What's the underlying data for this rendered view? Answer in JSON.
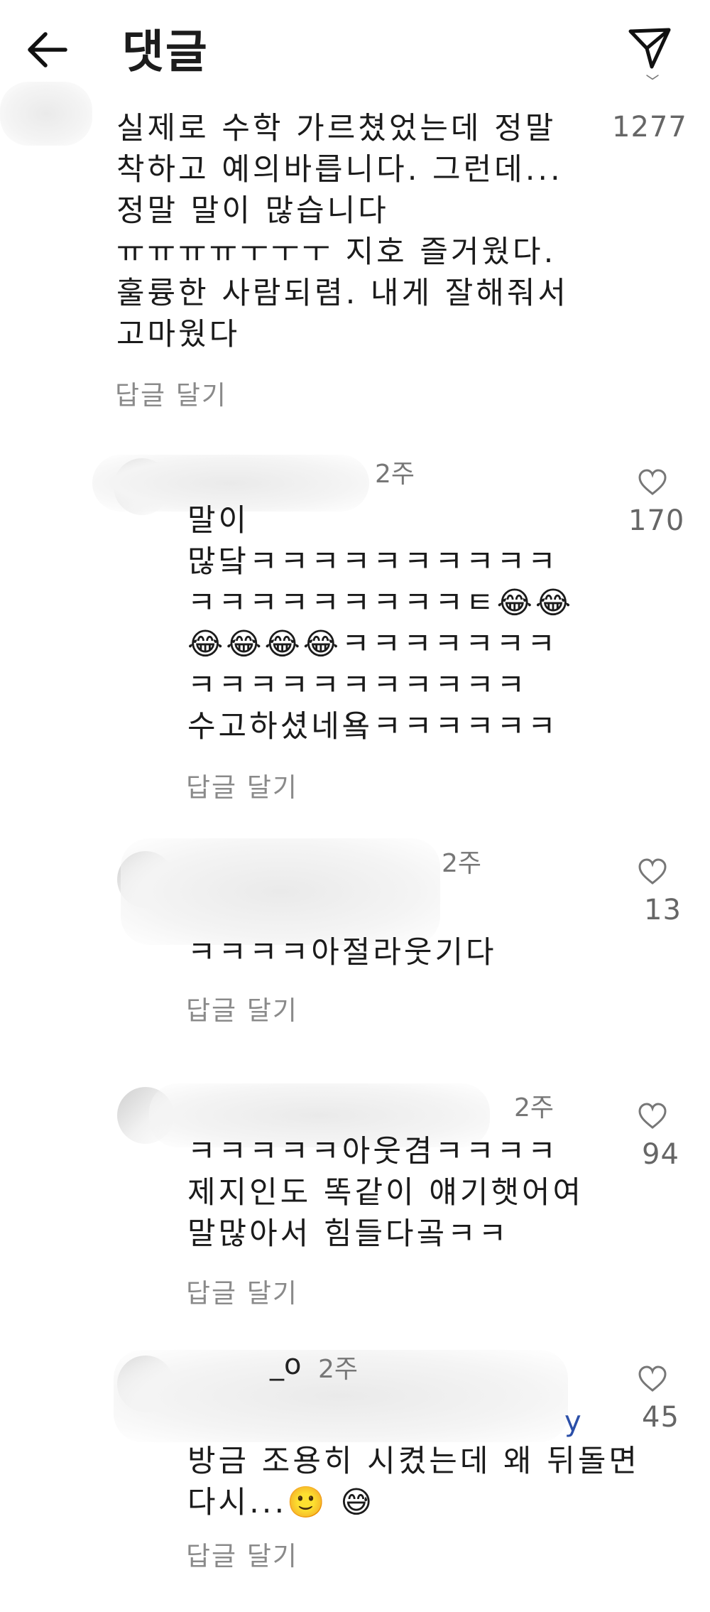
{
  "header": {
    "title": "댓글",
    "back_icon": "arrow-left-icon",
    "send_icon": "paper-plane-icon"
  },
  "comments": [
    {
      "time": "",
      "text": "실제로 수학 가르쳤었는데 정말\n착하고 예의바릅니다. 그런데...\n정말 말이 많습니다\nㅠㅠㅠㅠㅜㅜㅜ 지호 즐거웠다.\n훌륭한 사람되렴. 내게 잘해줘서\n고마웠다",
      "reply_label": "답글 달기",
      "likes": "1277"
    },
    {
      "time": "2주",
      "text": "말이\n많닼ㅋㅋㅋㅋㅋㅋㅋㅋㅋㅋ\nㅋㅋㅋㅋㅋㅋㅋㅋㅋㅌ😂😂\n😂😂😂😂ㅋㅋㅋㅋㅋㅋㅋ\nㅋㅋㅋㅋㅋㅋㅋㅋㅋㅋㅋ\n수고하셨네욬ㅋㅋㅋㅋㅋㅋ",
      "reply_label": "답글 달기",
      "likes": "170"
    },
    {
      "time": "2주",
      "text": "ㅋㅋㅋㅋ아절라웃기다",
      "reply_label": "답글 달기",
      "likes": "13"
    },
    {
      "time": "2주",
      "text": "ㅋㅋㅋㅋㅋ아웃겸ㅋㅋㅋㅋ\n제지인도 똑같이 얘기햇어여\n말많아서 힘들다곸ㅋㅋ",
      "reply_label": "답글 달기",
      "likes": "94"
    },
    {
      "name_fragment": "_o",
      "mention_fragment": "y",
      "time": "2주",
      "text": "방금 조용히 시켰는데 왜 뒤돌면\n다시...🙂 😅",
      "reply_label": "답글 달기",
      "likes": "45"
    }
  ]
}
